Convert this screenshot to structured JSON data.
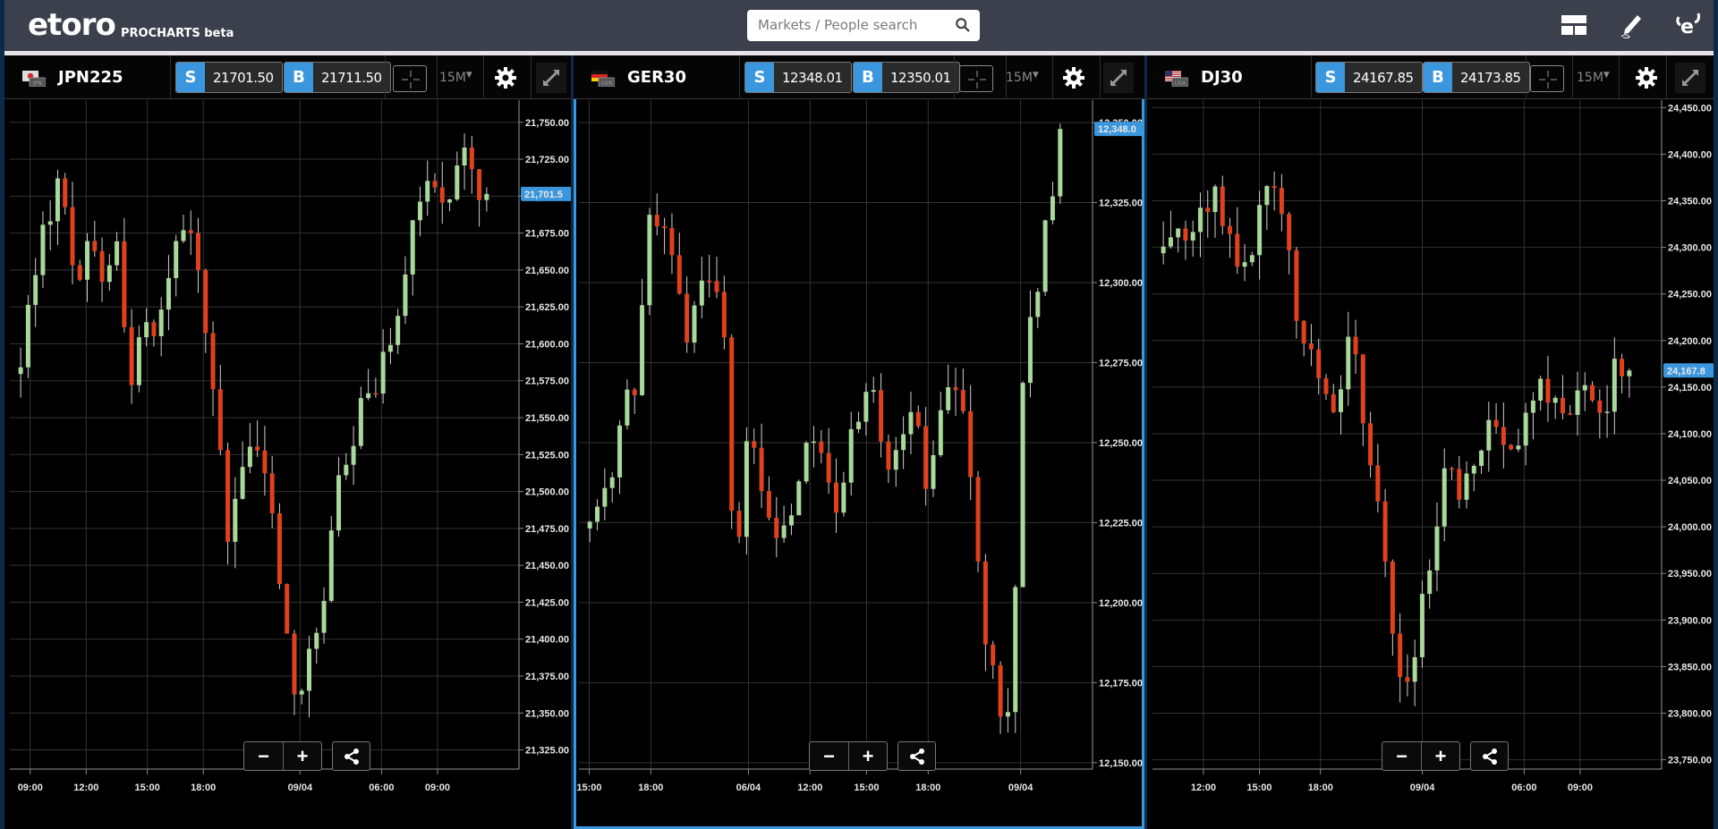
{
  "app": {
    "logo": "etoro",
    "subtitle": "PROCHARTS beta",
    "search_placeholder": "Markets / People search",
    "top_icons": [
      "layout-icon",
      "draw-icon",
      "etoro-profile-icon"
    ]
  },
  "colors": {
    "accent": "#3b97dd",
    "up_candle": "#a8d89a",
    "down_candle": "#e0401c",
    "wick": "#d0d0d0",
    "grid": "#333333",
    "background": "#000000",
    "topbar": "#3c3f4c"
  },
  "panels": [
    {
      "symbol": "JPN225",
      "flag": "JPN",
      "sell_label": "S",
      "sell": "21701.50",
      "buy_label": "B",
      "buy": "21711.50",
      "timeframe": "15M",
      "active": false
    },
    {
      "symbol": "GER30",
      "flag": "GER",
      "sell_label": "S",
      "sell": "12348.01",
      "buy_label": "B",
      "buy": "12350.01",
      "timeframe": "15M",
      "active": true
    },
    {
      "symbol": "DJ30",
      "flag": "USA",
      "sell_label": "S",
      "sell": "24167.85",
      "buy_label": "B",
      "buy": "24173.85",
      "timeframe": "15M",
      "active": false
    }
  ],
  "chart_data": [
    {
      "type": "candlestick",
      "title": "JPN225",
      "timeframe": "15M",
      "y_ticks": [
        "21,325.00",
        "21,350.00",
        "21,375.00",
        "21,400.00",
        "21,425.00",
        "21,450.00",
        "21,475.00",
        "21,500.00",
        "21,525.00",
        "21,550.00",
        "21,575.00",
        "21,600.00",
        "21,625.00",
        "21,650.00",
        "21,675.00",
        "21,700.00",
        "21,725.00",
        "21,750.00"
      ],
      "y_tick_values": [
        21325,
        21350,
        21375,
        21400,
        21425,
        21450,
        21475,
        21500,
        21525,
        21550,
        21575,
        21600,
        21625,
        21650,
        21675,
        21700,
        21725,
        21750
      ],
      "ylim": [
        21312,
        21765
      ],
      "x_ticks": [
        "09:00",
        "12:00",
        "15:00",
        "18:00",
        "09/04",
        "06:00",
        "09:00"
      ],
      "x_tick_positions": [
        0.04,
        0.15,
        0.27,
        0.38,
        0.57,
        0.73,
        0.84
      ],
      "current_price": 21701.5,
      "current_label": "21,701.5",
      "close_path": [
        21590,
        21640,
        21690,
        21710,
        21650,
        21660,
        21640,
        21670,
        21560,
        21620,
        21600,
        21660,
        21690,
        21640,
        21580,
        21470,
        21510,
        21550,
        21500,
        21440,
        21350,
        21390,
        21420,
        21500,
        21530,
        21560,
        21570,
        21600,
        21650,
        21690,
        21720,
        21690,
        21740,
        21710,
        21700
      ],
      "seed": 7
    },
    {
      "type": "candlestick",
      "title": "GER30",
      "timeframe": "15M",
      "y_ticks": [
        "12,150.00",
        "12,175.00",
        "12,200.00",
        "12,225.00",
        "12,250.00",
        "12,275.00",
        "12,300.00",
        "12,325.00",
        "12,350.00"
      ],
      "y_tick_values": [
        12150,
        12175,
        12200,
        12225,
        12250,
        12275,
        12300,
        12325,
        12350
      ],
      "ylim": [
        12148,
        12357
      ],
      "x_ticks": [
        "15:00",
        "18:00",
        "06/04",
        "12:00",
        "15:00",
        "18:00",
        "09/04"
      ],
      "x_tick_positions": [
        0.02,
        0.14,
        0.33,
        0.45,
        0.56,
        0.68,
        0.86
      ],
      "current_price": 12348.01,
      "current_label": "12,348.0",
      "close_path": [
        12228,
        12235,
        12245,
        12262,
        12272,
        12328,
        12315,
        12310,
        12282,
        12298,
        12302,
        12293,
        12210,
        12248,
        12244,
        12226,
        12222,
        12236,
        12246,
        12248,
        12229,
        12238,
        12258,
        12270,
        12256,
        12240,
        12250,
        12258,
        12236,
        12258,
        12270,
        12262,
        12220,
        12185,
        12168,
        12172,
        12280,
        12296,
        12320,
        12348
      ],
      "seed": 11
    },
    {
      "type": "candlestick",
      "title": "DJ30",
      "timeframe": "15M",
      "y_ticks": [
        "23,750.00",
        "23,800.00",
        "23,850.00",
        "23,900.00",
        "23,950.00",
        "24,000.00",
        "24,050.00",
        "24,100.00",
        "24,150.00",
        "24,200.00",
        "24,250.00",
        "24,300.00",
        "24,350.00",
        "24,400.00",
        "24,450.00"
      ],
      "y_tick_values": [
        23750,
        23800,
        23850,
        23900,
        23950,
        24000,
        24050,
        24100,
        24150,
        24200,
        24250,
        24300,
        24350,
        24400,
        24450
      ],
      "ylim": [
        23740,
        24458
      ],
      "x_ticks": [
        "12:00",
        "15:00",
        "18:00",
        "09/04",
        "06:00",
        "09:00"
      ],
      "x_tick_positions": [
        0.1,
        0.21,
        0.33,
        0.53,
        0.73,
        0.84
      ],
      "current_price": 24167.85,
      "current_label": "24,167.8",
      "close_path": [
        24310,
        24320,
        24300,
        24340,
        24360,
        24300,
        24280,
        24320,
        24390,
        24340,
        24230,
        24200,
        24140,
        24100,
        24220,
        24120,
        24050,
        23900,
        23820,
        23880,
        23960,
        24060,
        24040,
        24060,
        24080,
        24120,
        24080,
        24110,
        24140,
        24150,
        24130,
        24140,
        24160,
        24120,
        24180,
        24168
      ],
      "seed": 23
    }
  ]
}
